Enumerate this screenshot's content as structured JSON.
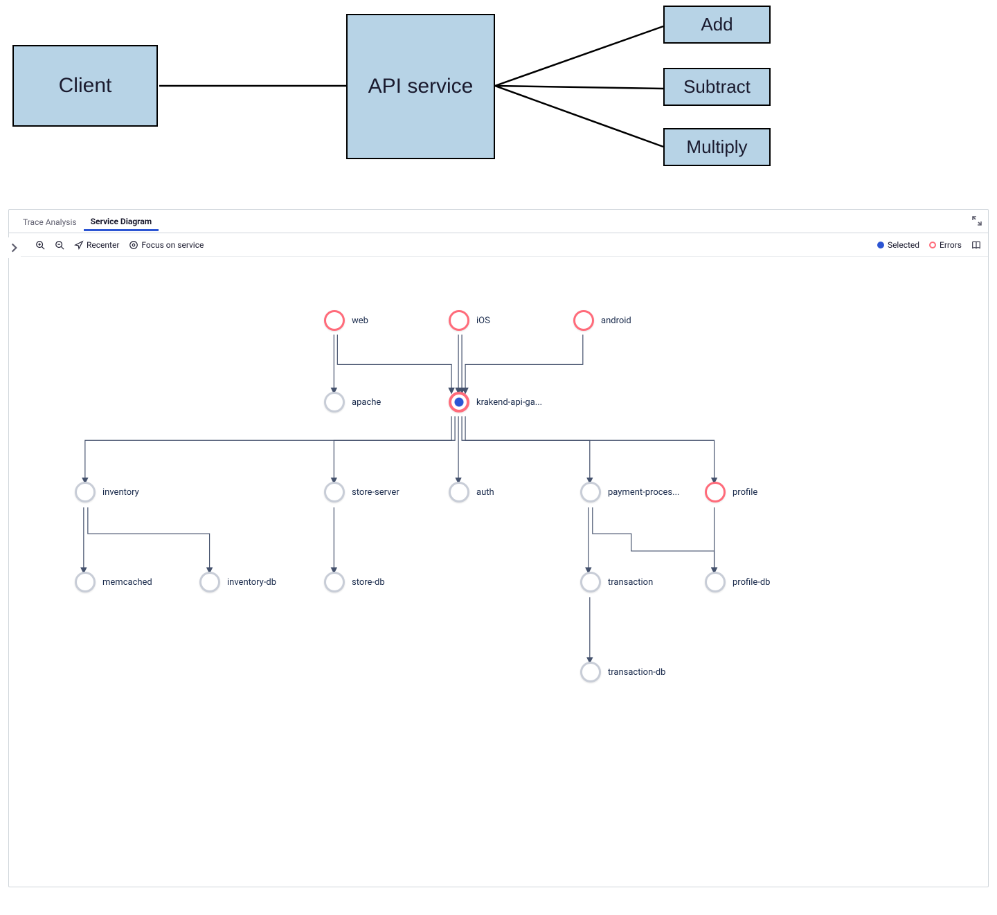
{
  "arch": {
    "client": "Client",
    "api": "API service",
    "ops": {
      "add": "Add",
      "subtract": "Subtract",
      "multiply": "Multiply"
    }
  },
  "panel": {
    "tabs": {
      "trace": "Trace Analysis",
      "diagram": "Service Diagram"
    },
    "toolbar": {
      "recenter": "Recenter",
      "focus": "Focus on service",
      "legend_selected": "Selected",
      "legend_errors": "Errors"
    },
    "nodes": {
      "web": "web",
      "ios": "iOS",
      "android": "android",
      "apache": "apache",
      "gateway": "krakend-api-ga...",
      "inventory": "inventory",
      "store_server": "store-server",
      "auth": "auth",
      "payment": "payment-proces...",
      "profile": "profile",
      "memcached": "memcached",
      "inventory_db": "inventory-db",
      "store_db": "store-db",
      "transaction": "transaction",
      "profile_db": "profile-db",
      "transaction_db": "transaction-db"
    }
  },
  "chart_data": {
    "type": "diagram",
    "title": "Service Diagram",
    "top_flow": {
      "nodes": [
        "Client",
        "API service",
        "Add",
        "Subtract",
        "Multiply"
      ],
      "edges": [
        [
          "Client",
          "API service"
        ],
        [
          "API service",
          "Add"
        ],
        [
          "API service",
          "Subtract"
        ],
        [
          "API service",
          "Multiply"
        ]
      ]
    },
    "service_graph": {
      "nodes": [
        {
          "id": "web",
          "state": "error"
        },
        {
          "id": "iOS",
          "state": "error"
        },
        {
          "id": "android",
          "state": "error"
        },
        {
          "id": "apache",
          "state": "normal"
        },
        {
          "id": "krakend-api-gateway",
          "label": "krakend-api-ga...",
          "state": "selected-error"
        },
        {
          "id": "inventory",
          "state": "normal"
        },
        {
          "id": "store-server",
          "state": "normal"
        },
        {
          "id": "auth",
          "state": "normal"
        },
        {
          "id": "payment-processor",
          "label": "payment-proces...",
          "state": "normal"
        },
        {
          "id": "profile",
          "state": "error"
        },
        {
          "id": "memcached",
          "state": "normal"
        },
        {
          "id": "inventory-db",
          "state": "normal"
        },
        {
          "id": "store-db",
          "state": "normal"
        },
        {
          "id": "transaction",
          "state": "normal"
        },
        {
          "id": "profile-db",
          "state": "normal"
        },
        {
          "id": "transaction-db",
          "state": "normal"
        }
      ],
      "edges": [
        [
          "web",
          "apache"
        ],
        [
          "web",
          "krakend-api-gateway"
        ],
        [
          "iOS",
          "krakend-api-gateway"
        ],
        [
          "android",
          "krakend-api-gateway"
        ],
        [
          "krakend-api-gateway",
          "inventory"
        ],
        [
          "krakend-api-gateway",
          "store-server"
        ],
        [
          "krakend-api-gateway",
          "auth"
        ],
        [
          "krakend-api-gateway",
          "payment-processor"
        ],
        [
          "krakend-api-gateway",
          "profile"
        ],
        [
          "inventory",
          "memcached"
        ],
        [
          "inventory",
          "inventory-db"
        ],
        [
          "store-server",
          "store-db"
        ],
        [
          "payment-processor",
          "transaction"
        ],
        [
          "payment-processor",
          "profile-db"
        ],
        [
          "profile",
          "profile-db"
        ],
        [
          "transaction",
          "transaction-db"
        ]
      ]
    }
  }
}
